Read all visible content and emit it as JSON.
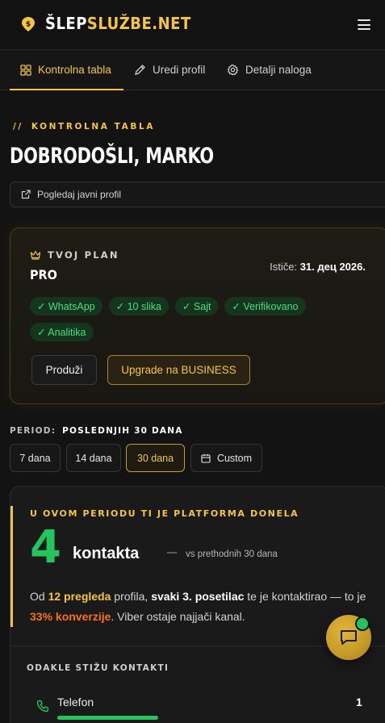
{
  "brand": {
    "part1": "ŠLEP",
    "part2": "SLUŽBE.NET"
  },
  "tabs": [
    {
      "label": "Kontrolna tabla",
      "icon": "grid-icon",
      "active": true
    },
    {
      "label": "Uredi profil",
      "icon": "pencil-icon",
      "active": false
    },
    {
      "label": "Detalji naloga",
      "icon": "gear-icon",
      "active": false
    }
  ],
  "dashboard": {
    "slashes": "//",
    "eyebrow": "KONTROLNA TABLA",
    "greeting": "DOBRODOŠLI, MARKO",
    "public_profile_link": "Pogledaj javni profil"
  },
  "plan": {
    "label": "TVOJ PLAN",
    "name": "PRO",
    "expiry_label": "Ističe:",
    "expiry_value": "31. дец 2026.",
    "features": [
      "✓ WhatsApp",
      "✓ 10 slika",
      "✓ Sajt",
      "✓ Verifikovano",
      "✓ Analitika"
    ],
    "renew_label": "Produži",
    "upgrade_label": "Upgrade na BUSINESS"
  },
  "period": {
    "label": "PERIOD:",
    "value": "POSLEDNJIH 30 DANA",
    "options": [
      "7 dana",
      "14 dana",
      "30 dana",
      "Custom"
    ],
    "selected": "30 dana"
  },
  "stats": {
    "title": "U OVOM PERIODU TI JE PLATFORMA DONELA",
    "count": "4",
    "unit": "kontakta",
    "dash": "—",
    "comparison": "vs prethodnih 30 dana",
    "summary": {
      "p1": "Od ",
      "views": "12 pregleda",
      "p2": " profila, ",
      "ratio": "svaki 3. posetilac",
      "p3": " te je kontaktirao — to je ",
      "conversion": "33% konverzije",
      "p4": ". Viber ostaje najjači kanal."
    },
    "sources_title": "ODAKLE STIŽU KONTAKTI",
    "sources": [
      {
        "label": "Telefon",
        "count": "1",
        "icon": "phone-icon",
        "share": 1.0
      }
    ]
  },
  "colors": {
    "accent": "#f5c542",
    "success": "#22c55e",
    "highlight": "#f97316",
    "background": "#131313"
  },
  "chat": {
    "icon": "chat-bubble-icon",
    "online": true
  }
}
